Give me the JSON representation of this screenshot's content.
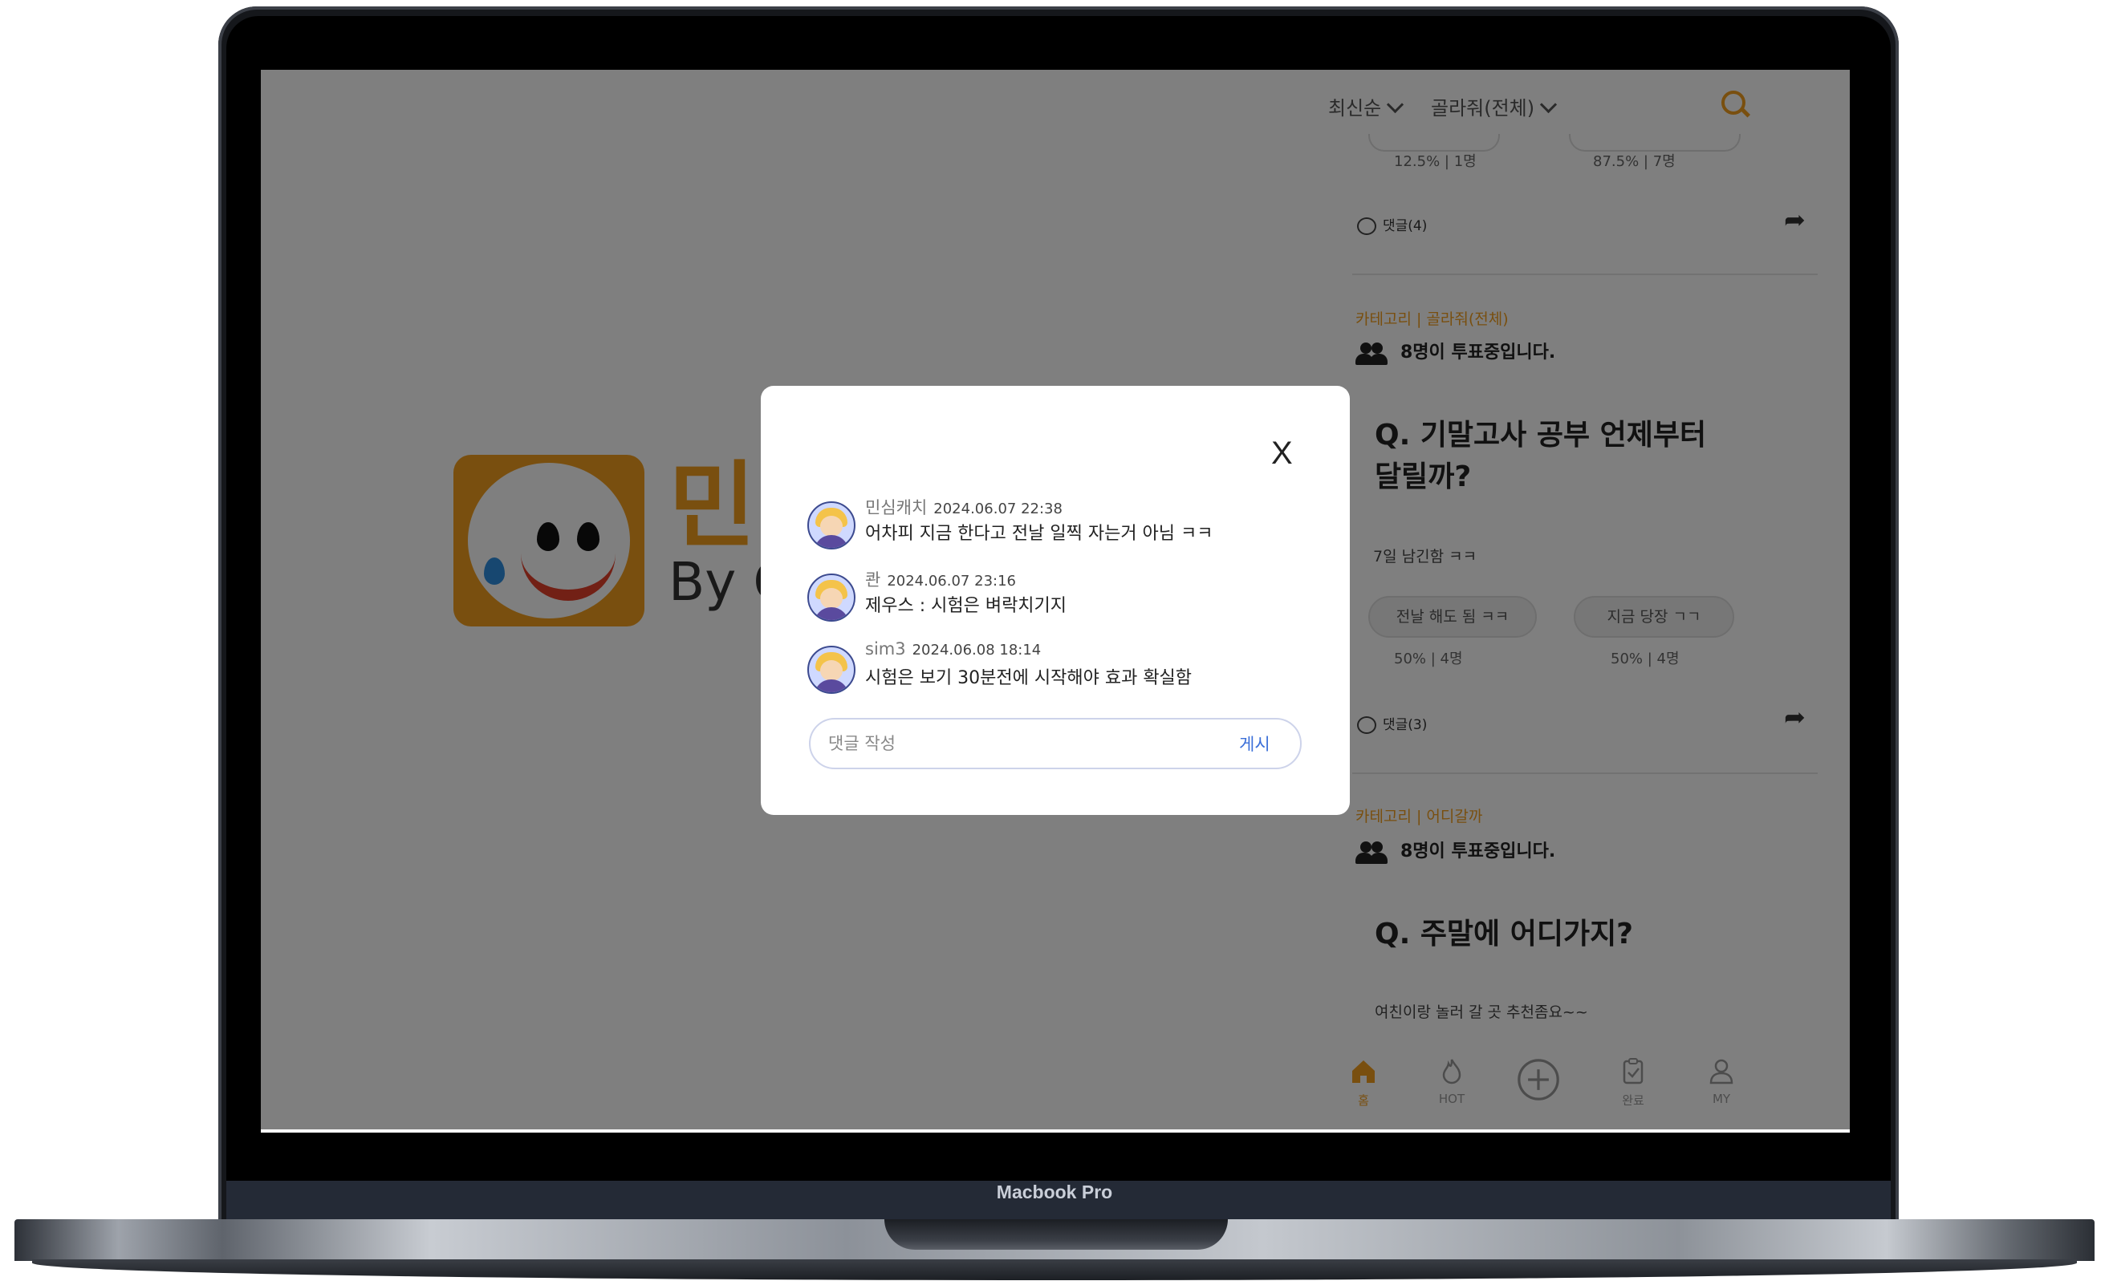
{
  "device": {
    "model_label": "Macbook Pro"
  },
  "splash": {
    "brand_char": "민",
    "by_text": "By C"
  },
  "feed": {
    "sort_options": [
      "최신순",
      "골라줘(전체)"
    ],
    "post1": {
      "options": [
        {
          "percent": "12.5%",
          "count": "1명"
        },
        {
          "percent": "87.5%",
          "count": "7명"
        }
      ],
      "comments_label": "댓글(4)"
    },
    "post2": {
      "category": "카테고리 | 골라줘(전체)",
      "voters": "8명이 투표중입니다.",
      "question_line1": "Q. 기말고사 공부 언제부터",
      "question_line2": "달릴까?",
      "remaining": "7일 남긴함 ㅋㅋ",
      "options": [
        {
          "label": "전날 해도 됨 ㅋㅋ",
          "percent": "50%",
          "count": "4명"
        },
        {
          "label": "지금 당장 ㄱㄱ",
          "percent": "50%",
          "count": "4명"
        }
      ],
      "comments_label": "댓글(3)"
    },
    "post3": {
      "category": "카테고리 | 어디갈까",
      "voters": "8명이 투표중입니다.",
      "question": "Q. 주말에 어디가지?",
      "subtext": "여친이랑 놀러 갈 곳 추천좀요~~"
    },
    "nav": [
      {
        "label": "홈",
        "icon": "home-icon",
        "active": true
      },
      {
        "label": "HOT",
        "icon": "flame-icon",
        "active": false
      },
      {
        "label": "",
        "icon": "plus-circle-icon",
        "active": false
      },
      {
        "label": "완료",
        "icon": "clipboard-icon",
        "active": false
      },
      {
        "label": "MY",
        "icon": "user-icon",
        "active": false
      }
    ]
  },
  "modal": {
    "close_label": "X",
    "comments": [
      {
        "name": "민심캐치",
        "date": "2024.06.07 22:38",
        "text": "어차피 지금 한다고 전날 일찍 자는거 아님 ㅋㅋ"
      },
      {
        "name": "콴",
        "date": "2024.06.07 23:16",
        "text": "제우스 : 시험은 벼락치기지"
      },
      {
        "name": "sim3",
        "date": "2024.06.08 18:14",
        "text": "시험은 보기 30분전에 시작해야 효과 확실함"
      }
    ],
    "input": {
      "placeholder": "댓글 작성",
      "value": ""
    },
    "post_label": "게시"
  },
  "colors": {
    "accent": "#f29e1e",
    "link": "#3b6fd8"
  }
}
